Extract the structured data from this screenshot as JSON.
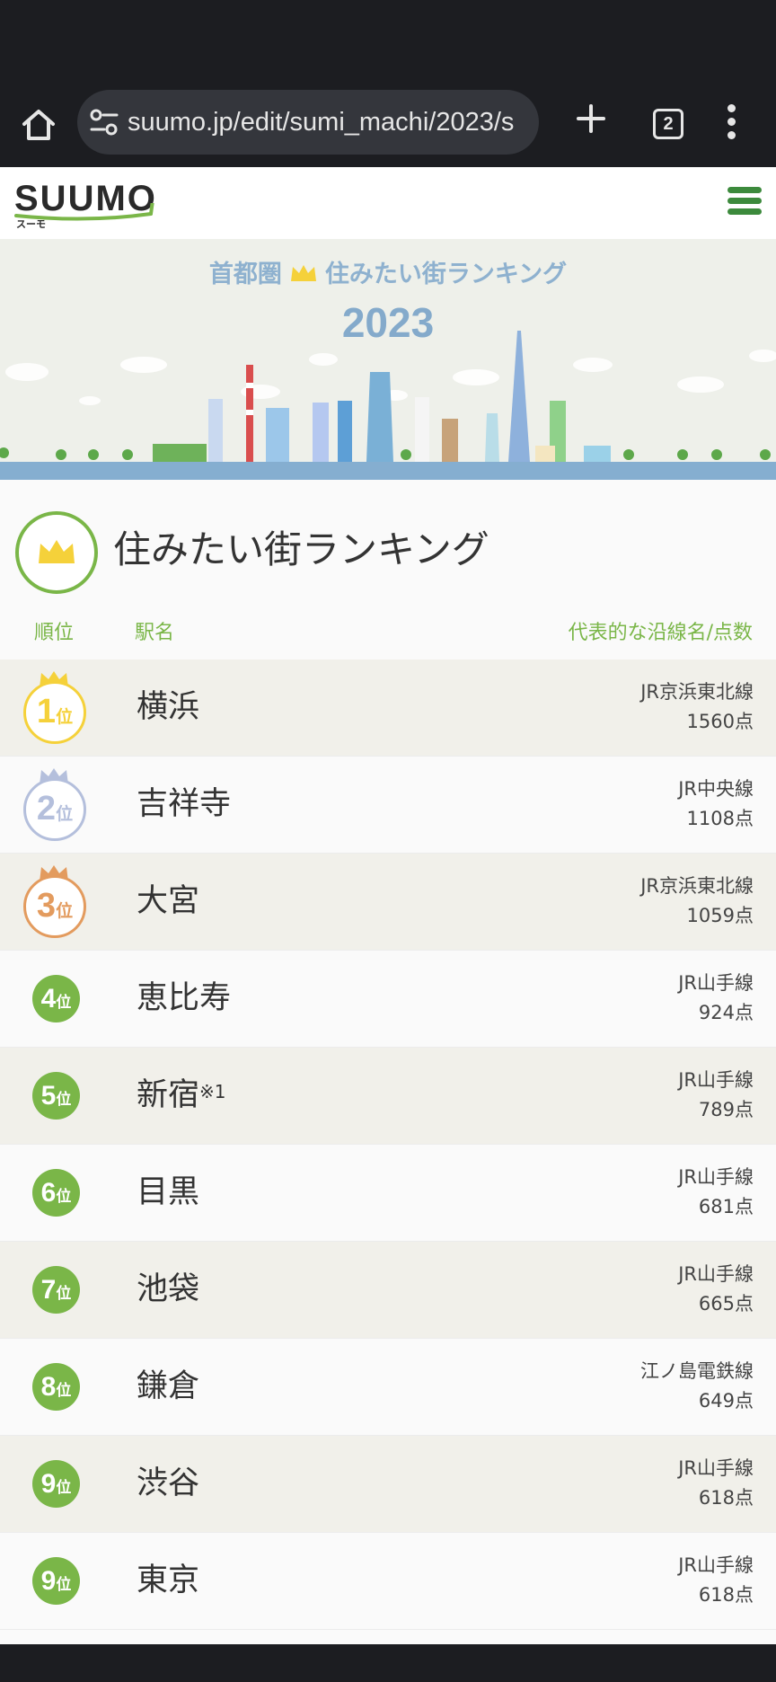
{
  "browser": {
    "url": "suumo.jp/edit/sumi_machi/2023/s",
    "tab_count": "2"
  },
  "site": {
    "logo": "SUUMO",
    "logo_sub": "スーモ"
  },
  "hero": {
    "title_left": "首都圏",
    "title_right": "住みたい街ランキング",
    "year": "2023"
  },
  "section": {
    "title": "住みたい街ランキング",
    "col_rank": "順位",
    "col_name": "駅名",
    "col_line": "代表的な沿線名/点数"
  },
  "colors": {
    "accent_green": "#7ab648",
    "gold": "#f5d13a",
    "silver": "#b4bfdc",
    "bronze": "#e39b5e"
  },
  "rankings": [
    {
      "rank": "1",
      "pos": "位",
      "station": "横浜",
      "note": "",
      "line": "JR京浜東北線",
      "points": "1560点"
    },
    {
      "rank": "2",
      "pos": "位",
      "station": "吉祥寺",
      "note": "",
      "line": "JR中央線",
      "points": "1108点"
    },
    {
      "rank": "3",
      "pos": "位",
      "station": "大宮",
      "note": "",
      "line": "JR京浜東北線",
      "points": "1059点"
    },
    {
      "rank": "4",
      "pos": "位",
      "station": "恵比寿",
      "note": "",
      "line": "JR山手線",
      "points": "924点"
    },
    {
      "rank": "5",
      "pos": "位",
      "station": "新宿",
      "note": "※1",
      "line": "JR山手線",
      "points": "789点"
    },
    {
      "rank": "6",
      "pos": "位",
      "station": "目黒",
      "note": "",
      "line": "JR山手線",
      "points": "681点"
    },
    {
      "rank": "7",
      "pos": "位",
      "station": "池袋",
      "note": "",
      "line": "JR山手線",
      "points": "665点"
    },
    {
      "rank": "8",
      "pos": "位",
      "station": "鎌倉",
      "note": "",
      "line": "江ノ島電鉄線",
      "points": "649点"
    },
    {
      "rank": "9",
      "pos": "位",
      "station": "渋谷",
      "note": "",
      "line": "JR山手線",
      "points": "618点"
    },
    {
      "rank": "9",
      "pos": "位",
      "station": "東京",
      "note": "",
      "line": "JR山手線",
      "points": "618点"
    }
  ]
}
